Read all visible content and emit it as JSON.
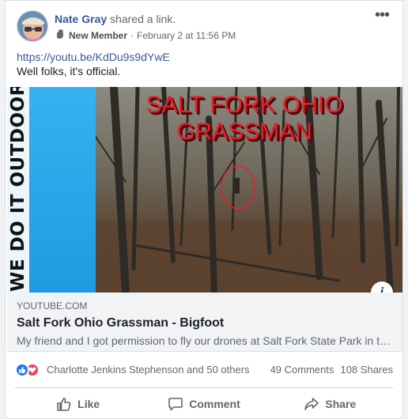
{
  "post": {
    "author_name": "Nate Gray",
    "action_text": "shared a link.",
    "member_badge": "New Member",
    "separator": "·",
    "timestamp": "February 2 at 11:56 PM",
    "more_label": "•••",
    "url_text": "https://youtu.be/KdDu9s9dYwE",
    "message": "Well folks, it's official."
  },
  "thumbnail": {
    "side_banner_text": "WE DO IT OUTDOORS",
    "title_line1": "SALT FORK OHIO",
    "title_line2": "GRASSMAN",
    "info_label": "i"
  },
  "link_preview": {
    "domain": "YOUTUBE.COM",
    "title": "Salt Fork Ohio Grassman - Bigfoot",
    "description": "My friend and I got permission to fly our drones at Salt Fork State Park in the middle of the forest..."
  },
  "engagement": {
    "reactors": "Charlotte Jenkins Stephenson and 50 others",
    "comments": "49 Comments",
    "shares": "108 Shares",
    "reaction_icons": [
      "like-icon",
      "love-icon"
    ]
  },
  "actions": {
    "like": "Like",
    "comment": "Comment",
    "share": "Share"
  },
  "colors": {
    "link": "#385898",
    "like_blue": "#1877f2",
    "love_red": "#f33e58",
    "thumbnail_title_red": "#e8202a",
    "banner_blue": "#34b3f0"
  }
}
